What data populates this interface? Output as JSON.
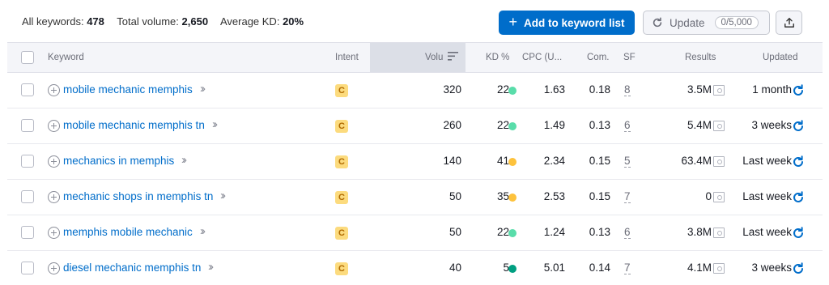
{
  "summary": {
    "all_keywords_label": "All keywords:",
    "all_keywords_value": "478",
    "total_volume_label": "Total volume:",
    "total_volume_value": "2,650",
    "average_kd_label": "Average KD:",
    "average_kd_value": "20%"
  },
  "toolbar": {
    "add_label": "Add to keyword list",
    "update_label": "Update",
    "update_count": "0/5,000",
    "accent_color": "#006dca"
  },
  "columns": {
    "keyword": "Keyword",
    "intent": "Intent",
    "volume": "Volu",
    "kd": "KD %",
    "cpc": "CPC (U...",
    "com": "Com.",
    "sf": "SF",
    "results": "Results",
    "updated": "Updated"
  },
  "rows": [
    {
      "keyword": "mobile mechanic memphis",
      "intent": "C",
      "volume": "320",
      "kd": "22",
      "kd_color": "#59ddaa",
      "cpc": "1.63",
      "com": "0.18",
      "sf": "8",
      "results": "3.5M",
      "updated": "1 month"
    },
    {
      "keyword": "mobile mechanic memphis tn",
      "intent": "C",
      "volume": "260",
      "kd": "22",
      "kd_color": "#59ddaa",
      "cpc": "1.49",
      "com": "0.13",
      "sf": "6",
      "results": "5.4M",
      "updated": "3 weeks"
    },
    {
      "keyword": "mechanics in memphis",
      "intent": "C",
      "volume": "140",
      "kd": "41",
      "kd_color": "#fdc23c",
      "cpc": "2.34",
      "com": "0.15",
      "sf": "5",
      "results": "63.4M",
      "updated": "Last week"
    },
    {
      "keyword": "mechanic shops in memphis tn",
      "intent": "C",
      "volume": "50",
      "kd": "35",
      "kd_color": "#fdc23c",
      "cpc": "2.53",
      "com": "0.15",
      "sf": "7",
      "results": "0",
      "updated": "Last week"
    },
    {
      "keyword": "memphis mobile mechanic",
      "intent": "C",
      "volume": "50",
      "kd": "22",
      "kd_color": "#59ddaa",
      "cpc": "1.24",
      "com": "0.13",
      "sf": "6",
      "results": "3.8M",
      "updated": "Last week"
    },
    {
      "keyword": "diesel mechanic memphis tn",
      "intent": "C",
      "volume": "40",
      "kd": "5",
      "kd_color": "#009f81",
      "cpc": "5.01",
      "com": "0.14",
      "sf": "7",
      "results": "4.1M",
      "updated": "3 weeks"
    }
  ]
}
